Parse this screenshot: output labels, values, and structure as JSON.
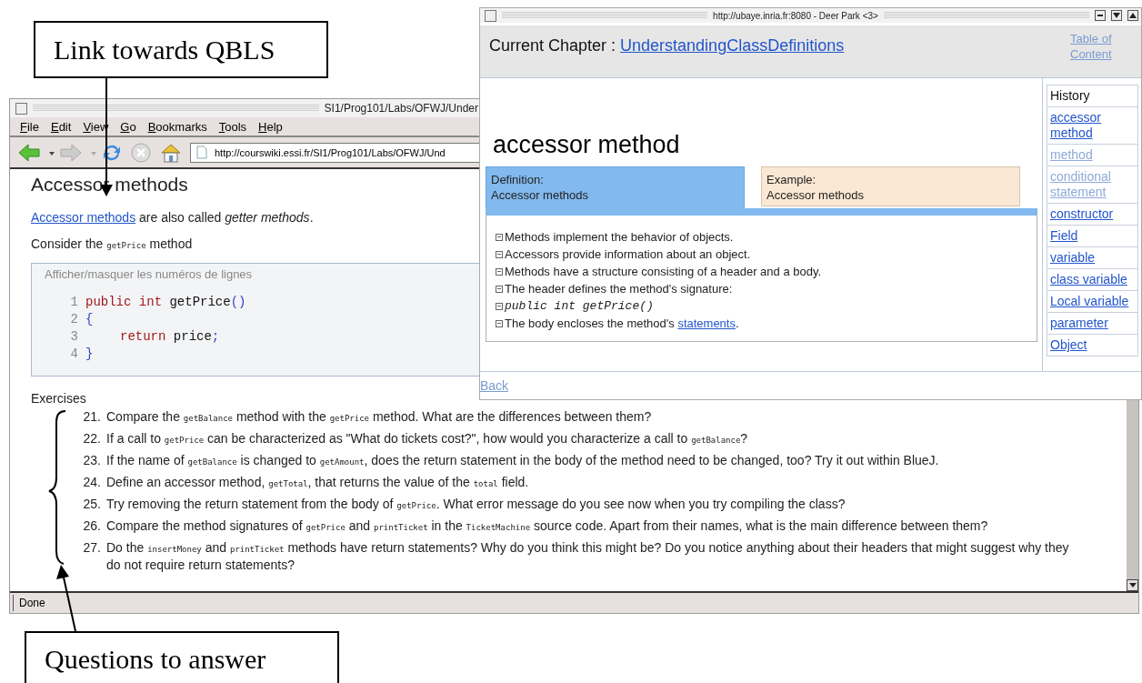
{
  "callouts": [
    {
      "label": "Link towards QBLS"
    },
    {
      "label": "Questions to answer"
    }
  ],
  "browser": {
    "title": "SI1/Prog101/Labs/OFWJ/Under",
    "menu": [
      {
        "label": "File"
      },
      {
        "label": "Edit"
      },
      {
        "label": "View"
      },
      {
        "label": "Go"
      },
      {
        "label": "Bookmarks"
      },
      {
        "label": "Tools"
      },
      {
        "label": "Help"
      }
    ],
    "url": "http://courswiki.essi.fr/SI1/Prog101/Labs/OFWJ/Und",
    "heading": "Accessor methods",
    "intro": {
      "link": "Accessor methods",
      "text": " are also called ",
      "emphasis": "getter methods",
      "end": "."
    },
    "consider": [
      {
        "kind": "text",
        "t": "Consider the "
      },
      {
        "kind": "code",
        "t": "getPrice"
      },
      {
        "kind": "text",
        "t": " method"
      }
    ],
    "code_toggle": "Afficher/masquer les numéros de lignes",
    "code_lines": [
      {
        "number": "1",
        "indented": false,
        "tokens": [
          {
            "kind": "keyword",
            "t": "public"
          },
          {
            "kind": "keyword",
            "t": " int"
          },
          {
            "kind": "plain",
            "t": " getPrice"
          },
          {
            "kind": "punct",
            "t": "()"
          }
        ]
      },
      {
        "number": "2",
        "indented": false,
        "tokens": [
          {
            "kind": "punct",
            "t": "{"
          }
        ]
      },
      {
        "number": "3",
        "indented": true,
        "tokens": [
          {
            "kind": "keyword",
            "t": "return"
          },
          {
            "kind": "plain",
            "t": " price"
          },
          {
            "kind": "punct",
            "t": ";"
          }
        ]
      },
      {
        "number": "4",
        "indented": false,
        "tokens": [
          {
            "kind": "punct",
            "t": "}"
          }
        ]
      }
    ],
    "exercises_heading": "Exercises",
    "exercises": [
      {
        "number": "21.",
        "parts": [
          {
            "kind": "text",
            "t": "Compare the "
          },
          {
            "kind": "code",
            "t": "getBalance"
          },
          {
            "kind": "text",
            "t": " method with the "
          },
          {
            "kind": "code",
            "t": "getPrice"
          },
          {
            "kind": "text",
            "t": " method. What are the differences between them?"
          }
        ]
      },
      {
        "number": "22.",
        "parts": [
          {
            "kind": "text",
            "t": "If a call to "
          },
          {
            "kind": "code",
            "t": "getPrice"
          },
          {
            "kind": "text",
            "t": " can be characterized as \"What do tickets cost?\", how would you characterize a call to "
          },
          {
            "kind": "code",
            "t": "getBalance"
          },
          {
            "kind": "text",
            "t": "?"
          }
        ]
      },
      {
        "number": "23.",
        "parts": [
          {
            "kind": "text",
            "t": "If the name of "
          },
          {
            "kind": "code",
            "t": "getBalance"
          },
          {
            "kind": "text",
            "t": " is changed to "
          },
          {
            "kind": "code",
            "t": "getAmount"
          },
          {
            "kind": "text",
            "t": ", does the return statement in the body of the method need to be changed, too? Try it out within BlueJ."
          }
        ]
      },
      {
        "number": "24.",
        "parts": [
          {
            "kind": "text",
            "t": "Define an accessor method, "
          },
          {
            "kind": "code",
            "t": "getTotal"
          },
          {
            "kind": "text",
            "t": ", that returns the value of the "
          },
          {
            "kind": "code",
            "t": "total"
          },
          {
            "kind": "text",
            "t": " field."
          }
        ]
      },
      {
        "number": "25.",
        "parts": [
          {
            "kind": "text",
            "t": "Try removing the return statement from the body of "
          },
          {
            "kind": "code",
            "t": "getPrice"
          },
          {
            "kind": "text",
            "t": ". What error message do you see now when you try compiling the class?"
          }
        ]
      },
      {
        "number": "26.",
        "parts": [
          {
            "kind": "text",
            "t": "Compare the method signatures of "
          },
          {
            "kind": "code",
            "t": "getPrice"
          },
          {
            "kind": "text",
            "t": " and "
          },
          {
            "kind": "code",
            "t": "printTicket"
          },
          {
            "kind": "text",
            "t": " in the "
          },
          {
            "kind": "code",
            "t": "TicketMachine"
          },
          {
            "kind": "text",
            "t": " source code. Apart from their names, what is the main difference between them?"
          }
        ]
      },
      {
        "number": "27.",
        "parts": [
          {
            "kind": "text",
            "t": "Do the "
          },
          {
            "kind": "code",
            "t": "insertMoney"
          },
          {
            "kind": "text",
            "t": " and "
          },
          {
            "kind": "code",
            "t": "printTicket"
          },
          {
            "kind": "text",
            "t": " methods have return statements? Why do you think this might be? Do you notice anything about their headers that might suggest why they do not require return statements?"
          }
        ]
      }
    ],
    "status": "Done"
  },
  "popup": {
    "title": "http://ubaye.inria.fr:8080 - Deer Park <3>",
    "chapter_label": "Current Chapter : ",
    "chapter_link": "UnderstandingClassDefinitions",
    "toc_link": "Table of Content",
    "heading": "accessor method",
    "tabs": [
      {
        "kind": "definition",
        "label": "Definition:",
        "value": "Accessor methods",
        "selected": true
      },
      {
        "kind": "example",
        "label": "Example:",
        "value": "Accessor methods",
        "selected": false
      }
    ],
    "points": [
      {
        "kind": "text",
        "parts": [
          {
            "kind": "text",
            "t": "Methods implement the behavior of objects."
          }
        ]
      },
      {
        "kind": "text",
        "parts": [
          {
            "kind": "text",
            "t": "Accessors provide information about an object."
          }
        ]
      },
      {
        "kind": "text",
        "parts": [
          {
            "kind": "text",
            "t": "Methods have a structure consisting of a header and a body."
          }
        ]
      },
      {
        "kind": "text",
        "parts": [
          {
            "kind": "text",
            "t": "The header defines the method's signature:"
          }
        ]
      },
      {
        "kind": "code",
        "parts": [
          {
            "kind": "text",
            "t": "public int getPrice()"
          }
        ]
      },
      {
        "kind": "text",
        "parts": [
          {
            "kind": "text",
            "t": "The body encloses the method's "
          },
          {
            "kind": "link",
            "t": "statements"
          },
          {
            "kind": "text",
            "t": "."
          }
        ]
      }
    ],
    "history_label": "History",
    "history": [
      {
        "label": "accessor method",
        "visited": false
      },
      {
        "label": "method",
        "visited": true
      },
      {
        "label": "conditional statement",
        "visited": true
      },
      {
        "label": "constructor",
        "visited": false
      },
      {
        "label": "Field",
        "visited": false
      },
      {
        "label": "variable",
        "visited": false
      },
      {
        "label": "class variable",
        "visited": false
      },
      {
        "label": "Local variable",
        "visited": false
      },
      {
        "label": "parameter",
        "visited": false
      },
      {
        "label": "Object",
        "visited": false
      }
    ],
    "back_link": "Back"
  }
}
